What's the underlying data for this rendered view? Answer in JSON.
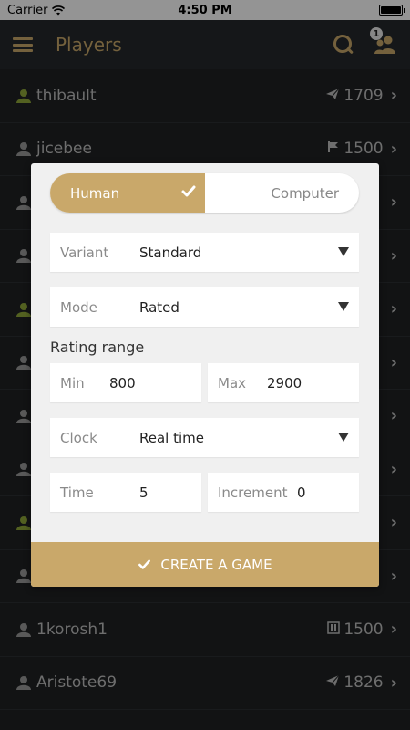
{
  "status_bar": {
    "carrier": "Carrier",
    "time": "4:50 PM"
  },
  "header": {
    "title": "Players",
    "notifications_count": "1"
  },
  "players": [
    {
      "name": "thibault",
      "rating": "1709",
      "icon": "paper-plane-icon",
      "online": true
    },
    {
      "name": "jicebee",
      "rating": "1500",
      "icon": "flag-icon",
      "online": false
    },
    {
      "name": "",
      "rating": "",
      "icon": "",
      "online": false
    },
    {
      "name": "",
      "rating": "",
      "icon": "",
      "online": false
    },
    {
      "name": "",
      "rating": "",
      "icon": "",
      "online": true
    },
    {
      "name": "",
      "rating": "",
      "icon": "",
      "online": false
    },
    {
      "name": "",
      "rating": "",
      "icon": "",
      "online": false
    },
    {
      "name": "",
      "rating": "",
      "icon": "",
      "online": false
    },
    {
      "name": "",
      "rating": "",
      "icon": "",
      "online": true
    },
    {
      "name": "",
      "rating": "",
      "icon": "",
      "online": false
    },
    {
      "name": "1korosh1",
      "rating": "1500",
      "icon": "board-icon",
      "online": false
    },
    {
      "name": "Aristote69",
      "rating": "1826",
      "icon": "paper-plane-icon",
      "online": false
    }
  ],
  "modal": {
    "toggle": {
      "human": "Human",
      "computer": "Computer"
    },
    "variant": {
      "label": "Variant",
      "value": "Standard"
    },
    "mode": {
      "label": "Mode",
      "value": "Rated"
    },
    "rating_range_title": "Rating range",
    "min": {
      "label": "Min",
      "value": "800"
    },
    "max": {
      "label": "Max",
      "value": "2900"
    },
    "clock": {
      "label": "Clock",
      "value": "Real time"
    },
    "time": {
      "label": "Time",
      "value": "5"
    },
    "increment": {
      "label": "Increment",
      "value": "0"
    },
    "create_button": "CREATE A GAME"
  },
  "colors": {
    "accent": "#c9a86a",
    "online": "#8fa83a",
    "offline": "#9a9a9a"
  }
}
